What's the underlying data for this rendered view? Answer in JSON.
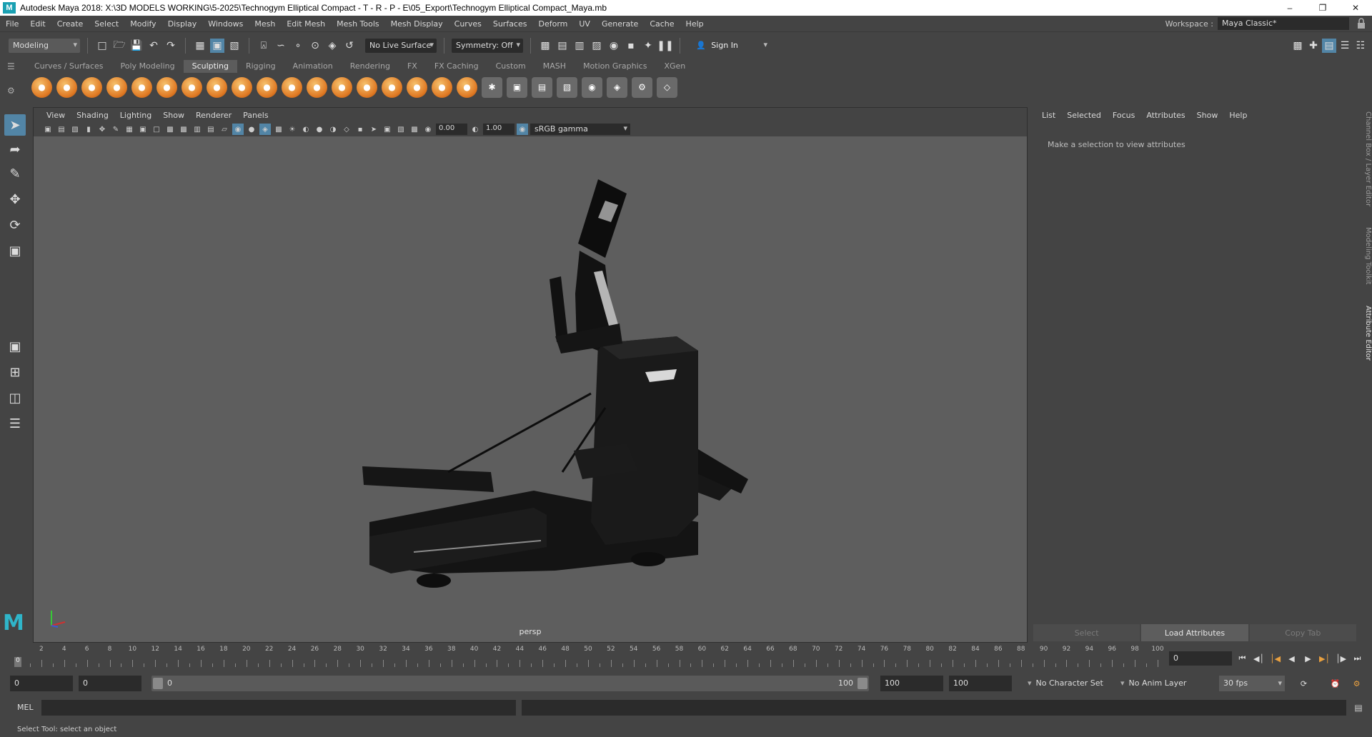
{
  "window": {
    "title": "Autodesk Maya 2018: X:\\3D MODELS WORKING\\5-2025\\Technogym Elliptical Compact - T - R - P - E\\05_Export\\Technogym Elliptical Compact_Maya.mb",
    "app_icon": "M",
    "minimize": "–",
    "restore": "❐",
    "close": "✕"
  },
  "menubar": {
    "items": [
      "File",
      "Edit",
      "Create",
      "Select",
      "Modify",
      "Display",
      "Windows",
      "Mesh",
      "Edit Mesh",
      "Mesh Tools",
      "Mesh Display",
      "Curves",
      "Surfaces",
      "Deform",
      "UV",
      "Generate",
      "Cache",
      "Help"
    ],
    "workspace_label": "Workspace :",
    "workspace_value": "Maya Classic*"
  },
  "statusline": {
    "menuset": "Modeling",
    "live_surface": "No Live Surface",
    "symmetry": "Symmetry: Off",
    "sign_in": "Sign In"
  },
  "shelf": {
    "tabs": [
      "Curves / Surfaces",
      "Poly Modeling",
      "Sculpting",
      "Rigging",
      "Animation",
      "Rendering",
      "FX",
      "FX Caching",
      "Custom",
      "MASH",
      "Motion Graphics",
      "XGen"
    ],
    "active_tab": "Sculpting"
  },
  "viewport": {
    "menus": [
      "View",
      "Shading",
      "Lighting",
      "Show",
      "Renderer",
      "Panels"
    ],
    "exposure": "0.00",
    "gamma": "1.00",
    "color_space": "sRGB gamma",
    "camera": "persp"
  },
  "attribute_editor": {
    "menus": [
      "List",
      "Selected",
      "Focus",
      "Attributes",
      "Show",
      "Help"
    ],
    "message": "Make a selection to view attributes",
    "buttons": {
      "select": "Select",
      "load": "Load Attributes",
      "copy": "Copy Tab"
    },
    "side_tabs": [
      "Channel Box / Layer Editor",
      "Modeling Toolkit",
      "Attribute Editor"
    ]
  },
  "timeslider": {
    "ticks": [
      "2",
      "4",
      "6",
      "8",
      "10",
      "12",
      "14",
      "16",
      "18",
      "20",
      "22",
      "24",
      "26",
      "28",
      "30",
      "32",
      "34",
      "36",
      "38",
      "40",
      "42",
      "44",
      "46",
      "48",
      "50",
      "52",
      "54",
      "56",
      "58",
      "60",
      "62",
      "64",
      "66",
      "68",
      "70",
      "72",
      "74",
      "76",
      "78",
      "80",
      "82",
      "84",
      "86",
      "88",
      "90",
      "92",
      "94",
      "96",
      "98",
      "100"
    ],
    "start_label": "0",
    "current_frame": "0"
  },
  "range": {
    "start_time": "0",
    "playback_start": "0",
    "slider_start": "0",
    "slider_end": "100",
    "playback_end": "100",
    "end_time": "100",
    "character_set": "No Character Set",
    "anim_layer": "No Anim Layer",
    "fps": "30 fps"
  },
  "commandline": {
    "label": "MEL"
  },
  "helpline": {
    "text": "Select Tool: select an object"
  }
}
